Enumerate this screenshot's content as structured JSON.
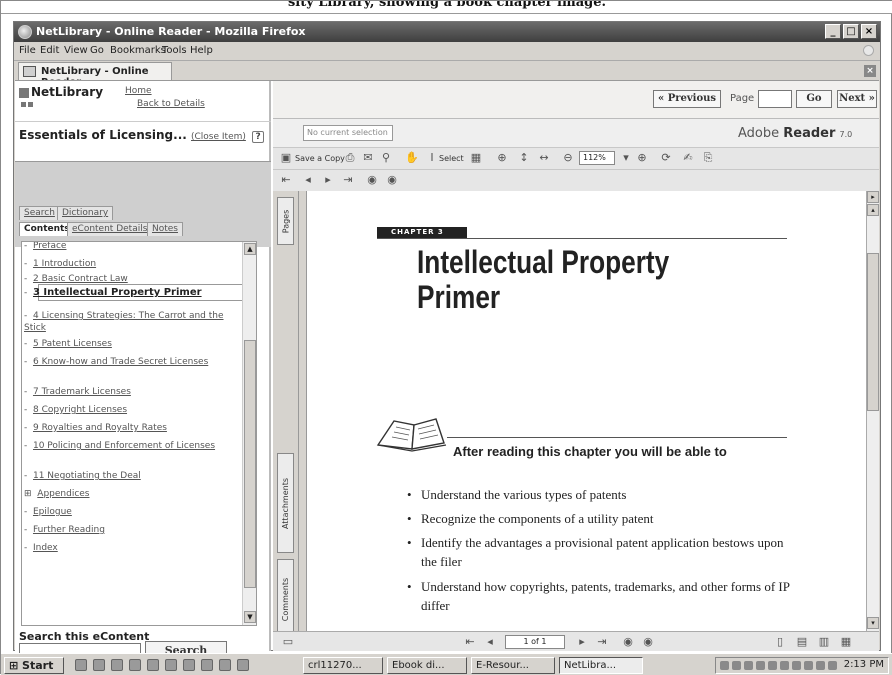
{
  "caption": "sity Library, showing a book chapter image.",
  "window": {
    "title": "NetLibrary - Online Reader - Mozilla Firefox",
    "controls": [
      "_",
      "□",
      "×"
    ]
  },
  "menu": [
    "File",
    "Edit",
    "View",
    "Go",
    "Bookmarks",
    "Tools",
    "Help"
  ],
  "tab": {
    "label": "NetLibrary - Online Reader",
    "close": "×"
  },
  "left": {
    "logo": "NetLibrary",
    "home_link": "Home",
    "back_link": "Back to Details",
    "book_title": "Essentials of Licensing...",
    "close_item": "(Close Item)",
    "help": "?",
    "tabs_row1": [
      "Search",
      "Dictionary"
    ],
    "tabs_row2": [
      "Contents",
      "eContent Details",
      "Notes"
    ],
    "toc": [
      {
        "prefix": "-",
        "label": "Preface"
      },
      {
        "prefix": "-",
        "label": "1 Introduction"
      },
      {
        "prefix": "-",
        "label": "2 Basic Contract Law"
      },
      {
        "prefix": "-",
        "label": "3 Intellectual Property Primer"
      },
      {
        "prefix": "-",
        "label": "4 Licensing Strategies: The Carrot and the Stick"
      },
      {
        "prefix": "-",
        "label": "5 Patent Licenses"
      },
      {
        "prefix": "-",
        "label": "6 Know-how and Trade Secret Licenses"
      },
      {
        "prefix": "-",
        "label": "7 Trademark Licenses"
      },
      {
        "prefix": "-",
        "label": "8 Copyright Licenses"
      },
      {
        "prefix": "-",
        "label": "9 Royalties and Royalty Rates"
      },
      {
        "prefix": "-",
        "label": "10 Policing and Enforcement of Licenses"
      },
      {
        "prefix": "-",
        "label": "11 Negotiating the Deal"
      },
      {
        "prefix": "⊞",
        "label": "Appendices"
      },
      {
        "prefix": "-",
        "label": "Epilogue"
      },
      {
        "prefix": "-",
        "label": "Further Reading"
      },
      {
        "prefix": "-",
        "label": "Index"
      }
    ],
    "search_label": "Search this eContent",
    "search_value": "",
    "search_button": "Search"
  },
  "nav": {
    "previous": "« Previous",
    "page_label": "Page",
    "page_value": "",
    "go": "Go",
    "next": "Next »"
  },
  "reader": {
    "no_selection": "No current selection",
    "logo": "Adobe",
    "logo_bold": "Reader",
    "version": "7.0",
    "save_copy": "Save a Copy",
    "select": "Select",
    "zoom": "112%",
    "side_tabs": [
      "Pages",
      "Attachments",
      "Comments"
    ],
    "page_counter": "1 of 1"
  },
  "page": {
    "chapter_label": "CHAPTER 3",
    "title": "Intellectual Property Primer",
    "after_heading": "After reading this chapter you will be able to",
    "bullets": [
      "Understand the various types of patents",
      "Recognize the components of a utility patent",
      "Identify the advantages a provisional patent application bestows upon the filer",
      "Understand how copyrights, patents, trademarks, and other forms of IP differ"
    ]
  },
  "taskbar": {
    "start": "Start",
    "buttons": [
      "crl11270...",
      "Ebook di...",
      "E-Resour...",
      "NetLibra..."
    ],
    "clock": "2:13 PM"
  }
}
